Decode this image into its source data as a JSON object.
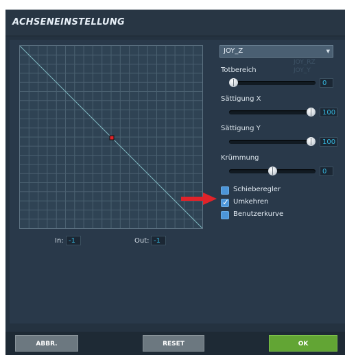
{
  "dialog": {
    "title": "ACHSENEINSTELLUNG"
  },
  "graph": {
    "in_label": "In:",
    "in_value": "-1",
    "out_label": "Out:",
    "out_value": "-1"
  },
  "axis_select": {
    "selected": "JOY_Z",
    "ghost_items": [
      "JOY_RZ",
      "JOY_Y"
    ]
  },
  "sliders": [
    {
      "label": "Totbereich",
      "value": "0",
      "level": 0.0
    },
    {
      "label": "Sättigung X",
      "value": "100",
      "level": 1.0
    },
    {
      "label": "Sättigung Y",
      "value": "100",
      "level": 1.0
    },
    {
      "label": "Krümmung",
      "value": "0",
      "level": 0.5
    }
  ],
  "options": [
    {
      "label": "Schieberegler",
      "checked": false
    },
    {
      "label": "Umkehren",
      "checked": true
    },
    {
      "label": "Benutzerkurve",
      "checked": false
    }
  ],
  "buttons": {
    "cancel": "ABBR.",
    "reset": "RESET",
    "ok": "OK"
  },
  "colors": {
    "accent_value": "#35b8e0",
    "checkbox": "#4c95d8",
    "ok_button": "#62a534",
    "arrow": "#e0232a",
    "curve_point": "#e0232a"
  }
}
